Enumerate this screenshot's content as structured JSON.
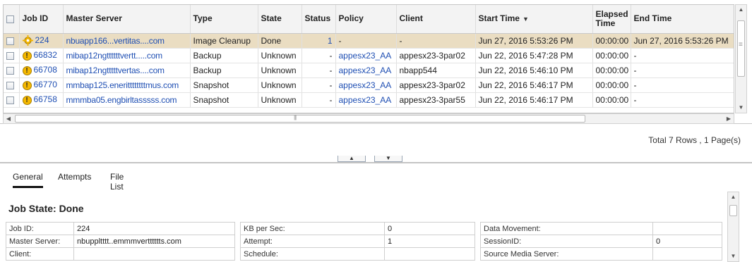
{
  "jobs_table": {
    "headers": {
      "job_id": "Job ID",
      "master_server": "Master Server",
      "type": "Type",
      "state": "State",
      "status": "Status",
      "policy": "Policy",
      "client": "Client",
      "start_time": "Start Time",
      "elapsed_time": "Elapsed Time",
      "end_time": "End Time"
    },
    "sort_indicator": "▼",
    "rows": [
      {
        "job_id": "224",
        "master_server": "nbuapp166...vertitas....com",
        "type": "Image Cleanup",
        "state": "Done",
        "status": "1",
        "policy": "-",
        "client": "-",
        "start_time": "Jun 27, 2016 5:53:26 PM",
        "elapsed": "00:00:00",
        "end_time": "Jun 27, 2016 5:53:26 PM",
        "icon": "image-cleanup-icon",
        "selected": true
      },
      {
        "job_id": "66832",
        "master_server": "mibap12ngttttttvertt.....com",
        "type": "Backup",
        "state": "Unknown",
        "status": "-",
        "policy": "appesx23_AA",
        "client": "appesx23-3par02",
        "start_time": "Jun 22, 2016 5:47:28 PM",
        "elapsed": "00:00:00",
        "end_time": "-",
        "icon": "warning-icon",
        "selected": false
      },
      {
        "job_id": "66708",
        "master_server": "mibap12ngtttttvertas....com",
        "type": "Backup",
        "state": "Unknown",
        "status": "-",
        "policy": "appesx23_AA",
        "client": "nbapp544",
        "start_time": "Jun 22, 2016 5:46:10 PM",
        "elapsed": "00:00:00",
        "end_time": "-",
        "icon": "warning-icon",
        "selected": false
      },
      {
        "job_id": "66770",
        "master_server": "mmbap125.enerittttttttmus.com",
        "type": "Snapshot",
        "state": "Unknown",
        "status": "-",
        "policy": "appesx23_AA",
        "client": "appesx23-3par02",
        "start_time": "Jun 22, 2016 5:46:17 PM",
        "elapsed": "00:00:00",
        "end_time": "-",
        "icon": "warning-icon",
        "selected": false
      },
      {
        "job_id": "66758",
        "master_server": "mmmba05.engbirltasssss.com",
        "type": "Snapshot",
        "state": "Unknown",
        "status": "-",
        "policy": "appesx23_AA",
        "client": "appesx23-3par55",
        "start_time": "Jun 22, 2016 5:46:17 PM",
        "elapsed": "00:00:00",
        "end_time": "-",
        "icon": "warning-icon",
        "selected": false
      }
    ]
  },
  "pagination": {
    "summary": "Total 7 Rows , 1 Page(s)"
  },
  "details": {
    "tabs": [
      "General",
      "Attempts",
      "File List"
    ],
    "active_tab": "General",
    "title": "Job State: Done",
    "col1": [
      {
        "label": "Job ID:",
        "value": "224"
      },
      {
        "label": "Master Server:",
        "value": "nbuppltttt..emmmvertttttts.com"
      },
      {
        "label": "Client:",
        "value": ""
      }
    ],
    "col2": [
      {
        "label": "KB per Sec:",
        "value": "0"
      },
      {
        "label": "Attempt:",
        "value": "1"
      },
      {
        "label": "Schedule:",
        "value": ""
      }
    ],
    "col3": [
      {
        "label": "Data Movement:",
        "value": ""
      },
      {
        "label": "SessionID:",
        "value": "0"
      },
      {
        "label": "Source Media Server:",
        "value": ""
      }
    ]
  },
  "colors": {
    "selected_row": "#eaddc2",
    "link": "#1f4fb3",
    "warning": "#f5b800"
  }
}
